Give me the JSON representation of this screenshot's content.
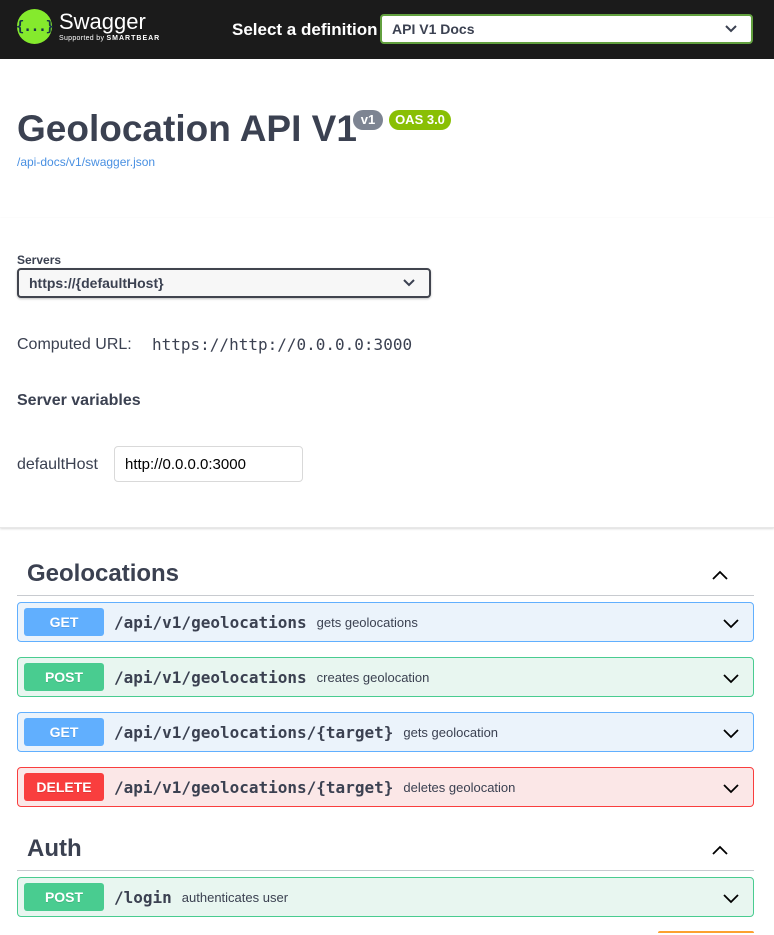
{
  "topbar": {
    "logo_icon": "{...}",
    "logo_name": "Swagger",
    "logo_supported": "Supported by",
    "logo_company": "SMARTBEAR",
    "definition_label": "Select a definition",
    "definition_value": "API V1 Docs"
  },
  "info": {
    "title": "Geolocation API V1",
    "version_badge": "v1",
    "oas_badge": "OAS 3.0",
    "spec_link": "/api-docs/v1/swagger.json"
  },
  "servers": {
    "label": "Servers",
    "selected": "https://{defaultHost}",
    "computed_label": "Computed URL:",
    "computed_value": "https://http://0.0.0.0:3000",
    "variables_heading": "Server variables",
    "variable_name": "defaultHost",
    "variable_value": "http://0.0.0.0:3000"
  },
  "tags": [
    {
      "name": "Geolocations",
      "operations": [
        {
          "method": "GET",
          "path": "/api/v1/geolocations",
          "summary": "gets geolocations"
        },
        {
          "method": "POST",
          "path": "/api/v1/geolocations",
          "summary": "creates geolocation"
        },
        {
          "method": "GET",
          "path": "/api/v1/geolocations/{target}",
          "summary": "gets geolocation"
        },
        {
          "method": "DELETE",
          "path": "/api/v1/geolocations/{target}",
          "summary": "deletes geolocation"
        }
      ]
    },
    {
      "name": "Auth",
      "operations": [
        {
          "method": "POST",
          "path": "/login",
          "summary": "authenticates user"
        }
      ]
    }
  ],
  "colors": {
    "get": "#61affe",
    "post": "#49cc90",
    "delete": "#f93e3e",
    "brand": "#85ea2d"
  }
}
